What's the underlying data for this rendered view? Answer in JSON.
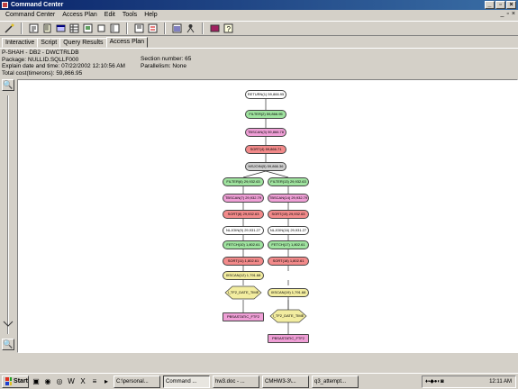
{
  "window": {
    "title": "Command Center"
  },
  "menubar": {
    "items": [
      "Command Center",
      "Access Plan",
      "Edit",
      "Tools",
      "Help"
    ]
  },
  "toolbar": {
    "icons": [
      "wizard-icon",
      "command-icon",
      "script-icon",
      "history-icon",
      "results-icon",
      "access-plan-icon",
      "window-icon",
      "options-icon",
      "log-icon",
      "show-sql-icon",
      "statistics-icon",
      "settings-icon",
      "help-icon"
    ]
  },
  "tabs": [
    "Interactive",
    "Script",
    "Query Results",
    "Access Plan"
  ],
  "info": {
    "line1": "P-SHAH - DB2 - DWCTRLDB",
    "line2": "Package: NULLID.SQLLF000",
    "line3": "Explain date and time: 07/22/2002 12:10:56 AM",
    "line4": "Total cost(timerons): 59,866.95",
    "section": "Section number: 65",
    "parallelism": "Parallelism: None"
  },
  "plan": {
    "nodes": [
      {
        "label": "RETURN(1) 59,866.95",
        "color": "#ffffff"
      },
      {
        "label": "FILTER(2) 59,866.95",
        "color": "#9fe39f"
      },
      {
        "label": "TBSCAN(3) 59,866.78",
        "color": "#ef9fd6"
      },
      {
        "label": "SORT(4) 59,866.71",
        "color": "#f28a8a"
      },
      {
        "label": "MSJOIN(5) 59,866.36",
        "color": "#cfcfcf"
      },
      {
        "label": "FILTER(6) 29,932.63",
        "color": "#9fe39f"
      },
      {
        "label": "FILTER(13) 29,932.63",
        "color": "#9fe39f"
      },
      {
        "label": "TBSCAN(7) 29,932.79",
        "color": "#ef9fd6"
      },
      {
        "label": "TBSCAN(14) 29,932.79",
        "color": "#ef9fd6"
      },
      {
        "label": "SORT(8) 29,932.63",
        "color": "#f28a8a"
      },
      {
        "label": "SORT(15) 29,932.63",
        "color": "#f28a8a"
      },
      {
        "label": "NLJOIN(9) 29,931.27",
        "color": "#ffffff"
      },
      {
        "label": "NLJOIN(16) 29,931.27",
        "color": "#ffffff"
      },
      {
        "label": "FETCH(10) 1,802.61",
        "color": "#9fe39f"
      },
      {
        "label": "FETCH(17) 1,802.61",
        "color": "#9fe39f"
      },
      {
        "label": "SORT(11) 1,802.61",
        "color": "#f28a8a"
      },
      {
        "label": "SORT(18) 1,802.61",
        "color": "#f28a8a"
      },
      {
        "label": "IXSCAN(12) 1,791.68",
        "color": "#f3eda0"
      },
      {
        "label": "IXSCAN(19) 1,791.68",
        "color": "#f3eda0"
      },
      {
        "label": "I_TF2_DATE_TIME",
        "color": "#f3eda0"
      },
      {
        "label": "I_TF2_DATE_TIME",
        "color": "#f3eda0"
      },
      {
        "label": "PBSASTATIC_FTF2",
        "color": "#ef9fd6"
      },
      {
        "label": "PBSASTATIC_FTF2",
        "color": "#ef9fd6"
      }
    ]
  },
  "taskbar": {
    "start": "Start",
    "buttons": [
      "C:\\personal...",
      "Command ...",
      "hw3.doc - ...",
      "CMHW3-3\\...",
      "q3_attempt..."
    ],
    "clock": "12:11 AM"
  }
}
